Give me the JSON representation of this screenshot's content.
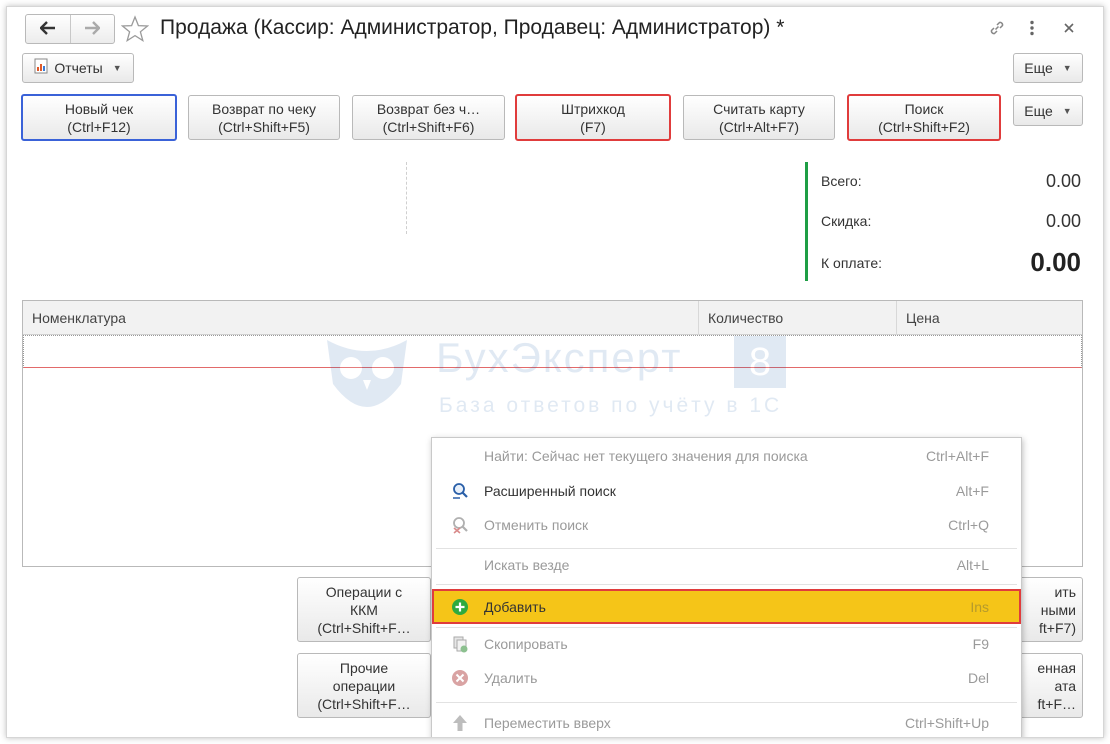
{
  "window": {
    "title": "Продажа (Кассир: Администратор, Продавец: Администратор) *"
  },
  "toolbar": {
    "reports_label": "Отчеты",
    "more_label_top": "Еще",
    "more_label": "Еще"
  },
  "actions": [
    {
      "line1": "Новый чек",
      "line2": "(Ctrl+F12)"
    },
    {
      "line1": "Возврат по чеку",
      "line2": "(Ctrl+Shift+F5)"
    },
    {
      "line1": "Возврат без ч…",
      "line2": "(Ctrl+Shift+F6)"
    },
    {
      "line1": "Штрихкод",
      "line2": "(F7)"
    },
    {
      "line1": "Считать карту",
      "line2": "(Ctrl+Alt+F7)"
    },
    {
      "line1": "Поиск",
      "line2": "(Ctrl+Shift+F2)"
    }
  ],
  "totals": {
    "total_label": "Всего:",
    "total_value": "0.00",
    "discount_label": "Скидка:",
    "discount_value": "0.00",
    "pay_label": "К оплате:",
    "pay_value": "0.00"
  },
  "table": {
    "columns": [
      "Номенклатура",
      "Количество",
      "Цена"
    ]
  },
  "watermark": {
    "brand": "БухЭксперт",
    "digit": "8",
    "tagline": "База ответов по учёту в 1С"
  },
  "bottom_buttons": {
    "kkm": {
      "line1": "Операции с",
      "line2": "ККМ",
      "line3": "(Ctrl+Shift+F…"
    },
    "other": {
      "line1": "Прочие",
      "line2": "операции",
      "line3": "(Ctrl+Shift+F…"
    },
    "right_top": {
      "line1": "ить",
      "line2": "ными",
      "line3": "ft+F7)"
    },
    "right_bottom": {
      "line1": "енная",
      "line2": "ата",
      "line3": "ft+F…"
    }
  },
  "context_menu": {
    "items": [
      {
        "label": "Найти: Сейчас нет текущего значения для поиска",
        "shortcut": "Ctrl+Alt+F",
        "icon": "none",
        "disabled": true
      },
      {
        "label": "Расширенный поиск",
        "shortcut": "Alt+F",
        "icon": "search-icon",
        "disabled": false
      },
      {
        "label": "Отменить поиск",
        "shortcut": "Ctrl+Q",
        "icon": "cancel-search-icon",
        "disabled": true
      },
      {
        "label": "Искать везде",
        "shortcut": "Alt+L",
        "icon": "none",
        "disabled": true
      },
      {
        "label": "Добавить",
        "shortcut": "Ins",
        "icon": "add-icon",
        "disabled": false
      },
      {
        "label": "Скопировать",
        "shortcut": "F9",
        "icon": "copy-icon",
        "disabled": true
      },
      {
        "label": "Удалить",
        "shortcut": "Del",
        "icon": "delete-icon",
        "disabled": true
      },
      {
        "label": "Переместить вверх",
        "shortcut": "Ctrl+Shift+Up",
        "icon": "arrow-up-icon",
        "disabled": true
      }
    ]
  },
  "colors": {
    "highlight_red": "#e03c3c",
    "highlight_blue": "#3a62d8",
    "menu_active": "#f5c518",
    "totals_bar": "#1e9e45",
    "add_icon": "#2eaa3f"
  }
}
